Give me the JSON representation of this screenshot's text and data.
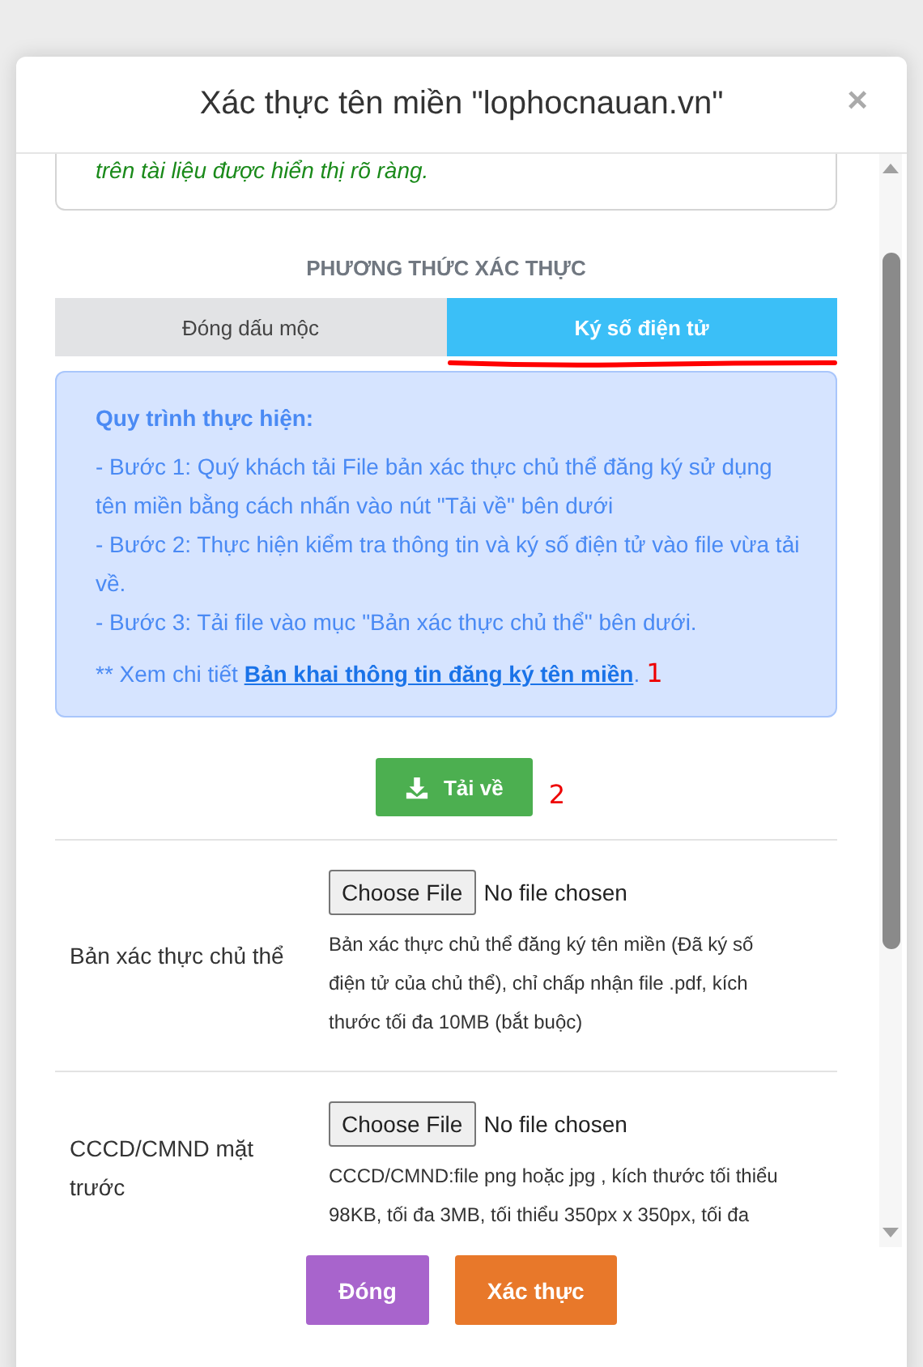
{
  "dialog": {
    "title": "Xác thực tên miền \"lophocnauan.vn\"",
    "close": "×"
  },
  "notice_tail": "trên tài liệu được hiển thị rõ ràng.",
  "method": {
    "heading": "PHƯƠNG THỨC XÁC THỰC",
    "tabs": [
      {
        "label": "Đóng dấu mộc",
        "selected": false
      },
      {
        "label": "Ký số điện tử",
        "selected": true
      }
    ]
  },
  "instructions": {
    "title": "Quy trình thực hiện:",
    "steps": [
      "- Bước 1: Quý khách tải File bản xác thực chủ thể đăng ký sử dụng tên miền bằng cách nhấn vào nút \"Tải về\" bên dưới",
      "- Bước 2: Thực hiện kiểm tra thông tin và ký số điện tử vào file vừa tải về.",
      "- Bước 3: Tải file vào mục \"Bản xác thực chủ thể\" bên dưới."
    ],
    "detail_prefix": "** Xem chi tiết ",
    "detail_link": "Bản khai thông tin đăng ký tên miền",
    "detail_suffix": ".",
    "annotation": "1"
  },
  "download": {
    "label": "Tải về",
    "annotation": "2"
  },
  "uploads": [
    {
      "label": "Bản xác thực chủ thể",
      "button": "Choose File",
      "status": "No file chosen",
      "hint": "Bản xác thực chủ thể đăng ký tên miền (Đã ký số điện tử của chủ thể), chỉ chấp nhận file .pdf, kích thước tối đa 10MB (bắt buộc)"
    },
    {
      "label": "CCCD/CMND mặt trước",
      "button": "Choose File",
      "status": "No file chosen",
      "hint": "CCCD/CMND:file png hoặc jpg , kích thước tối thiểu 98KB, tối đa 3MB, tối thiểu 350px x 350px, tối đa"
    }
  ],
  "footer": {
    "buttons": [
      {
        "label": "Đóng",
        "kind": "close"
      },
      {
        "label": "Xác thực",
        "kind": "submit"
      }
    ]
  }
}
